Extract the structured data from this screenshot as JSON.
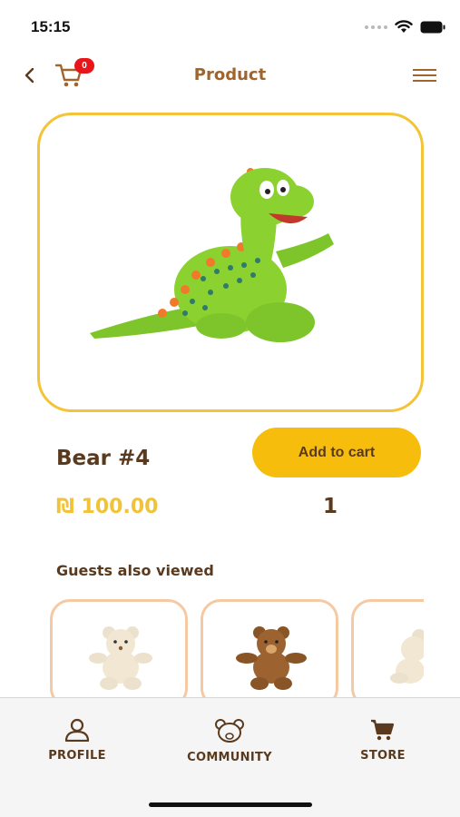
{
  "status_bar": {
    "time": "15:15"
  },
  "nav": {
    "title": "Product",
    "cart_count": "0"
  },
  "product": {
    "name": "Bear #4",
    "price": "₪ 100.00",
    "quantity": "1",
    "add_to_cart_label": "Add to cart",
    "image_subject": "green-dinosaur-plush"
  },
  "guests_also_viewed": {
    "title": "Guests also viewed",
    "items": [
      {
        "image_subject": "cream-teddy-bear"
      },
      {
        "image_subject": "brown-teddy-bear"
      },
      {
        "image_subject": "cream-teddy-bear-partial"
      }
    ]
  },
  "tab_bar": {
    "items": [
      {
        "label": "PROFILE",
        "icon": "person-icon"
      },
      {
        "label": "COMMUNITY",
        "icon": "bear-head-icon"
      },
      {
        "label": "STORE",
        "icon": "cart-icon"
      }
    ]
  },
  "colors": {
    "accent_yellow": "#f7bd0c",
    "frame_yellow": "#f3c437",
    "brown_text": "#5a3a1e",
    "title_brown": "#a0652d",
    "badge_red": "#e8151b",
    "card_border": "#f5c9a3"
  }
}
